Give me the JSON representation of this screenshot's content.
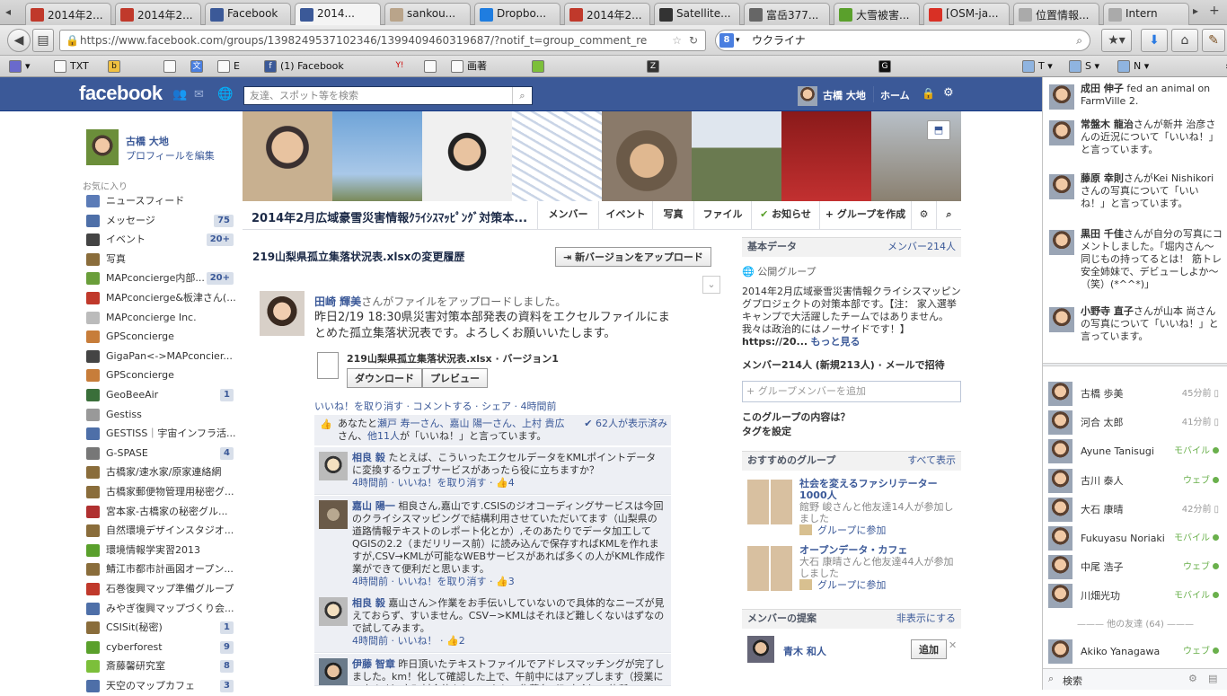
{
  "browser": {
    "tabs": [
      {
        "label": "2014年2...",
        "icon": "farmville-icon",
        "color": "#c0392b"
      },
      {
        "label": "2014年2...",
        "icon": "farmville-icon",
        "color": "#c0392b"
      },
      {
        "label": "Facebook",
        "icon": "facebook-icon",
        "color": "#3b5998"
      },
      {
        "label": "2014...",
        "icon": "facebook-icon",
        "color": "#3b5998"
      },
      {
        "label": "sankou...",
        "icon": "app-icon",
        "color": "#b9a48a"
      },
      {
        "label": "Dropbo...",
        "icon": "dropbox-icon",
        "color": "#1f7de0"
      },
      {
        "label": "2014年2...",
        "icon": "farmville-icon",
        "color": "#c0392b"
      },
      {
        "label": "Satellite...",
        "icon": "nyt-icon",
        "color": "#333333"
      },
      {
        "label": "富岳377...",
        "icon": "page-icon",
        "color": "#666666"
      },
      {
        "label": "大雪被害...",
        "icon": "map-icon",
        "color": "#5aa02c"
      },
      {
        "label": "[OSM-ja...",
        "icon": "gmail-icon",
        "color": "#d93025"
      },
      {
        "label": "位置情報...",
        "icon": "page-icon",
        "color": "#aaaaaa"
      },
      {
        "label": "Intern",
        "icon": "page-icon",
        "color": "#aaaaaa"
      }
    ],
    "url": "https://www.facebook.com/groups/1398249537102346/1399409460319687/?notif_t=group_comment_re",
    "search": "ウクライナ",
    "bookmarks": [
      "TXT",
      "E",
      "(1) Facebook",
      "画著",
      "T",
      "S",
      "N"
    ]
  },
  "fb": {
    "logo": "facebook",
    "search_placeholder": "友達、スポット等を検索",
    "user_name": "古橋 大地",
    "home": "ホーム"
  },
  "left": {
    "profile_name": "古橋 大地",
    "edit_profile": "プロフィールを編集",
    "favorites_label": "お気に入り",
    "items": [
      {
        "label": "ニュースフィード",
        "count": "",
        "color": "#5b7bb7"
      },
      {
        "label": "メッセージ",
        "count": "75",
        "color": "#4e6fa8"
      },
      {
        "label": "イベント",
        "count": "20+",
        "color": "#444"
      },
      {
        "label": "写真",
        "count": "",
        "color": "#8a6d3b"
      },
      {
        "label": "MAPconcierge内部...",
        "count": "20+",
        "color": "#6a9e3a"
      },
      {
        "label": "MAPconcierge&板津さん(...",
        "count": "",
        "color": "#c0392b"
      },
      {
        "label": "MAPconcierge Inc.",
        "count": "",
        "color": "#bbb"
      },
      {
        "label": "GPSconcierge",
        "count": "",
        "color": "#c77d3a"
      },
      {
        "label": "GigaPan<->MAPconcier...",
        "count": "",
        "color": "#444"
      },
      {
        "label": "GPSconcierge",
        "count": "",
        "color": "#c77d3a"
      },
      {
        "label": "GeoBeeAir",
        "count": "1",
        "color": "#3a6f3a"
      },
      {
        "label": "Gestiss",
        "count": "",
        "color": "#999"
      },
      {
        "label": "GESTISS｜宇宙インフラ活...",
        "count": "",
        "color": "#4e6fa8"
      },
      {
        "label": "G-SPASE",
        "count": "4",
        "color": "#777"
      },
      {
        "label": "古橋家/速水家/原家連絡網",
        "count": "",
        "color": "#8a6d3b"
      },
      {
        "label": "古橋家郵便物管理用秘密グ...",
        "count": "",
        "color": "#8a6d3b"
      },
      {
        "label": "宮本家-古橋家の秘密グル...",
        "count": "",
        "color": "#b03030"
      },
      {
        "label": "自然環境デザインスタジオ...",
        "count": "",
        "color": "#8a6d3b"
      },
      {
        "label": "環境情報学実習2013",
        "count": "",
        "color": "#5aa02c"
      },
      {
        "label": "鯖江市都市計画図オープン...",
        "count": "",
        "color": "#8a6d3b"
      },
      {
        "label": "石巻復興マップ準備グループ",
        "count": "",
        "color": "#c0392b"
      },
      {
        "label": "みやぎ復興マップづくり会...",
        "count": "",
        "color": "#4e6fa8"
      },
      {
        "label": "CSISit(秘密)",
        "count": "1",
        "color": "#8a6d3b"
      },
      {
        "label": "cyberforest",
        "count": "9",
        "color": "#5aa02c"
      },
      {
        "label": "斎藤馨研究室",
        "count": "8",
        "color": "#7cbf3a"
      },
      {
        "label": "天空のマップカフェ",
        "count": "3",
        "color": "#4e6fa8"
      }
    ]
  },
  "group": {
    "title": "2014年2月広域豪雪災害情報ｸﾗｲｼｽﾏｯﾋﾟﾝｸﾞ対策本...",
    "tabs": [
      "メンバー",
      "イベント",
      "写真",
      "ファイル",
      "お知らせ",
      "+ グループを作成"
    ]
  },
  "post": {
    "heading": "219山梨県孤立集落状況表.xlsxの変更履歴",
    "upload_button": "新バージョンをアップロード",
    "author": "田崎 輝美",
    "action": "さんがファイルをアップロードしました。",
    "body": "昨日2/19 18:30県災害対策本部発表の資料をエクセルファイルにまとめた孤立集落状況表です。よろしくお願いいたします。",
    "file_name": "219山梨県孤立集落状況表.xlsx",
    "version": "バージョン1",
    "download": "ダウンロード",
    "preview": "プレビュー",
    "actions": "いいね！を取り消す · コメントする · シェア · 4時間前",
    "likes_prefix": "あなたと",
    "likes_names": "瀬戸 寿一さん、嘉山 陽一さん、上村 貴広",
    "likes_others": "他11人",
    "likes_suffix": "さん、",
    "likes_tail": "が「いいね！」と言っています。",
    "seen": "62人が表示済み",
    "comments": [
      {
        "name": "相良 毅",
        "text": "たとえば、こういったエクセルデータをKMLポイントデータに変換するウェブサービスがあったら役に立ちますか？",
        "meta": "4時間前 · いいね！を取り消す · ",
        "likes": "4"
      },
      {
        "name": "嘉山 陽一",
        "text": "相良さん,嘉山です.CSISのジオコーディングサービスは今回のクライシスマッピングで結構利用させていただいてます（山梨県の道路情報テキストのレポート化とか）,そのあたりでデータ加工してQGISの2.2（まだリリース前）に読み込んで保存すればKMLを作れますが,CSV→KMLが可能なWEBサービスがあれば多くの人がKML作成作業ができて便利だと思います。",
        "meta": "4時間前 · いいね！を取り消す · ",
        "likes": "3"
      },
      {
        "name": "相良 毅",
        "text": "嘉山さん＞作業をお手伝いしていないので具体的なニーズが見えておらず、すいません。CSV−>KMLはそれほど難しくないはずなので試してみます。",
        "meta": "4時間前 · いいね！ · ",
        "likes": "2"
      },
      {
        "name": "伊藤 智章",
        "text": "昨日頂いたテキストファイルでアドレスマッチングが完了しました。km！化して確認した上で、午前中にはアップします（授業にて来ます）市町村全体をしていたり、集落名（町内会）一体所",
        "meta": "",
        "likes": ""
      }
    ]
  },
  "info": {
    "basic_header": "基本データ",
    "members_link": "メンバー214人",
    "public_group": "公開グループ",
    "desc": "2014年2月広域豪雪災害情報クライシスマッピングプロジェクトの対策本部です。【注： 家入選挙キャンプで大活躍したチームではありません。我々は政治的にはノーサイドです！】",
    "more_url": "https://20...",
    "more": "もっと見る",
    "member_count": "メンバー214人 (新規213人)",
    "invite": "メールで招待",
    "add_placeholder": "+ グループメンバーを追加",
    "about_q": "このグループの内容は？",
    "tags": "タグを設定",
    "rec_header": "おすすめのグループ",
    "show_all": "すべて表示",
    "rec_groups": [
      {
        "name": "社会を変えるファシリテーター1000人",
        "friends": "館野 峻さんと他友達14人が参加しました",
        "join": "グループに参加"
      },
      {
        "name": "オープンデータ・カフェ",
        "friends": "大石 康晴さんと他友達44人が参加しました",
        "join": "グループに参加"
      }
    ],
    "suggest_header": "メンバーの提案",
    "hide": "非表示にする",
    "suggest_name": "青木 和人",
    "add": "追加"
  },
  "ticker": [
    {
      "name": "成田 伸子",
      "text": " fed an animal on FarmVille 2."
    },
    {
      "name": "常盤木 龍治",
      "text": "さんが新井 治彦さんの近況について「いいね！」と言っています。"
    },
    {
      "name": "藤原 幸則",
      "text": "さんがKei Nishikoriさんの写真について「いいね！」と言っています。"
    },
    {
      "name": "黒田 千佳",
      "text": "さんが自分の写真にコメントしました。「堀内さん〜同じもの持ってるとは！ 筋トレ安全姉妹で、デビューしよか〜（笑）(*^^*)」"
    },
    {
      "name": "小野寺 直子",
      "text": "さんが山本 尚さんの写真について「いいね！」と言っています。"
    }
  ],
  "chat": [
    {
      "name": "古橋 歩美",
      "status": "45分前",
      "mobile": false
    },
    {
      "name": "河合 太郎",
      "status": "41分前",
      "mobile": false
    },
    {
      "name": "Ayune Tanisugi",
      "status": "モバイル",
      "mobile": true
    },
    {
      "name": "古川 泰人",
      "status": "ウェブ",
      "mobile": true
    },
    {
      "name": "大石 康晴",
      "status": "42分前",
      "mobile": false
    },
    {
      "name": "Fukuyasu Noriaki",
      "status": "モバイル",
      "mobile": true
    },
    {
      "name": "中尾 浩子",
      "status": "ウェブ",
      "mobile": true
    },
    {
      "name": "川畑光功",
      "status": "モバイル",
      "mobile": true
    }
  ],
  "chat_other": "他の友達 (64)",
  "chat_other_friend": {
    "name": "Akiko Yanagawa",
    "status": "ウェブ"
  },
  "chat_search": "検索"
}
